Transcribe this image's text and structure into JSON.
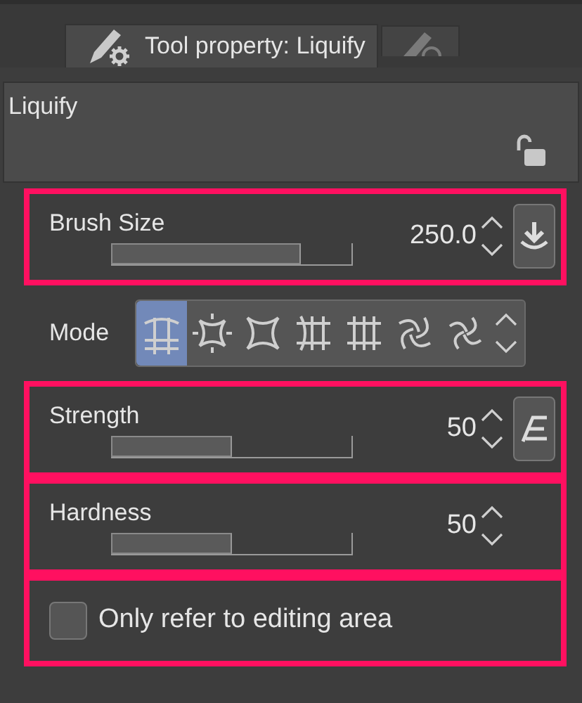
{
  "tabs": [
    {
      "label": "Tool property: Liquify",
      "selected": true
    },
    {
      "selected": false
    }
  ],
  "panel": {
    "title": "Liquify",
    "locked": false
  },
  "rows": [
    {
      "kind": "slider",
      "label": "Brush Size",
      "value": "250.0",
      "level": 0.79,
      "highlighted": true,
      "button": {
        "kind": "pressure"
      }
    },
    {
      "kind": "mode",
      "label": "Mode",
      "highlighted": false,
      "options": [
        {
          "selected": true
        },
        {
          "selected": false
        },
        {
          "selected": false
        },
        {
          "selected": false
        },
        {
          "selected": false
        },
        {
          "selected": false
        },
        {
          "selected": false
        }
      ]
    },
    {
      "kind": "slider",
      "label": "Strength",
      "value": "50",
      "level": 0.5,
      "highlighted": true,
      "button": {
        "kind": "curve"
      }
    },
    {
      "kind": "slider",
      "label": "Hardness",
      "value": "50",
      "level": 0.5,
      "highlighted": true
    },
    {
      "kind": "checkbox",
      "label": "Only refer to editing area",
      "checked": false,
      "highlighted": true
    }
  ]
}
